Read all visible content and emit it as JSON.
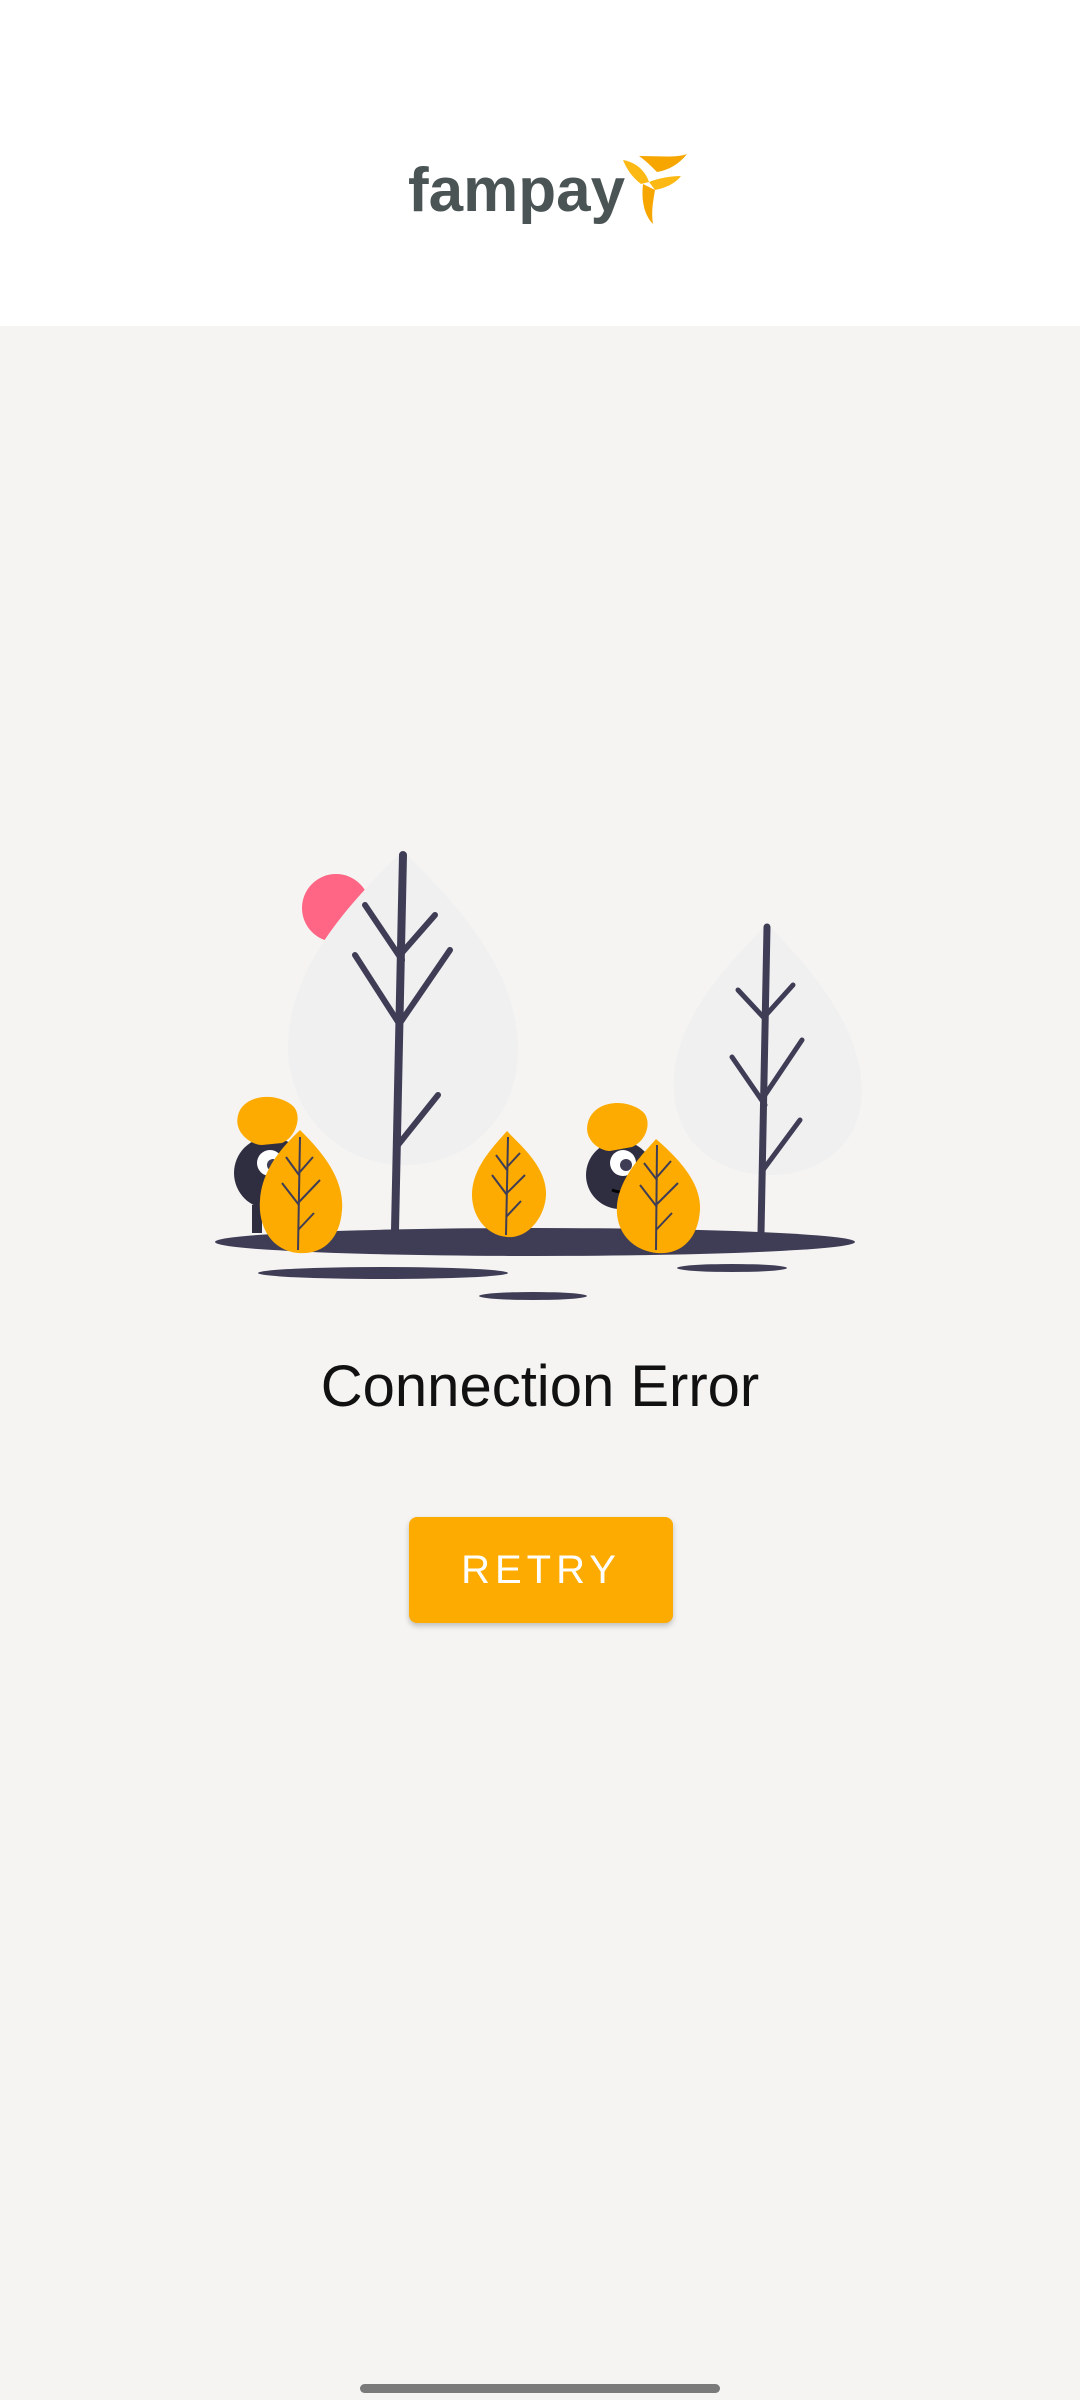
{
  "header": {
    "logo_text": "fampay",
    "logo_icon": "fampay-bird-icon"
  },
  "error": {
    "illustration": "trees-and-characters-illustration",
    "title": "Connection Error"
  },
  "actions": {
    "retry_label": "RETRY"
  },
  "colors": {
    "accent": "#fdab00",
    "background": "#f5f4f2",
    "header_bg": "#ffffff",
    "logo_text": "#4b5454",
    "sun": "#ff6584",
    "ground": "#3f3d56"
  }
}
